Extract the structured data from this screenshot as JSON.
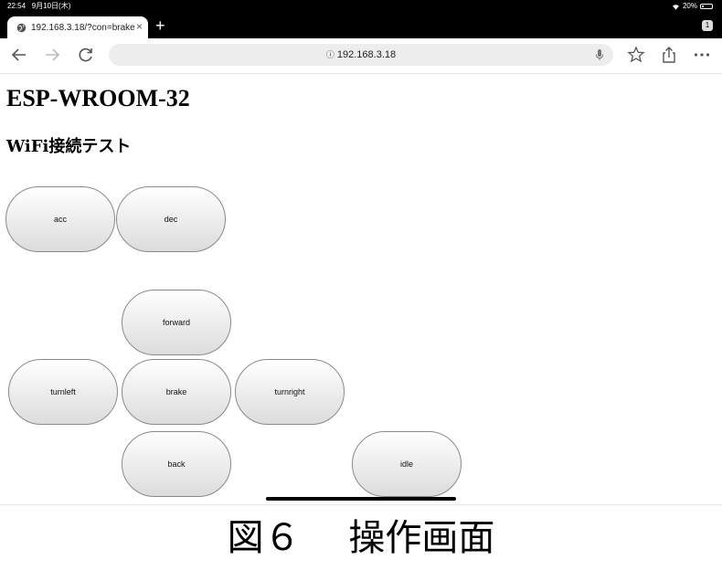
{
  "status_bar": {
    "time": "22:54",
    "date": "9月10日(木)",
    "battery": "20%"
  },
  "browser": {
    "tab_title": "192.168.3.18/?con=brake",
    "tab_close": "×",
    "new_tab": "+",
    "tab_count": "1",
    "url": "192.168.3.18",
    "url_info_glyph": "ⓘ"
  },
  "page": {
    "title": "ESP-WROOM-32",
    "subtitle": "WiFi接続テスト",
    "buttons": {
      "acc": "acc",
      "dec": "dec",
      "forward": "forward",
      "turnleft": "turnleft",
      "brake": "brake",
      "turnright": "turnright",
      "back": "back",
      "idle": "idle"
    }
  },
  "caption": "図６　 操作画面",
  "icons": [
    "wifi-icon",
    "battery-icon",
    "globe-icon",
    "back-arrow-icon",
    "forward-arrow-icon",
    "reload-icon",
    "info-icon",
    "mic-icon",
    "star-icon",
    "share-icon",
    "more-icon"
  ]
}
